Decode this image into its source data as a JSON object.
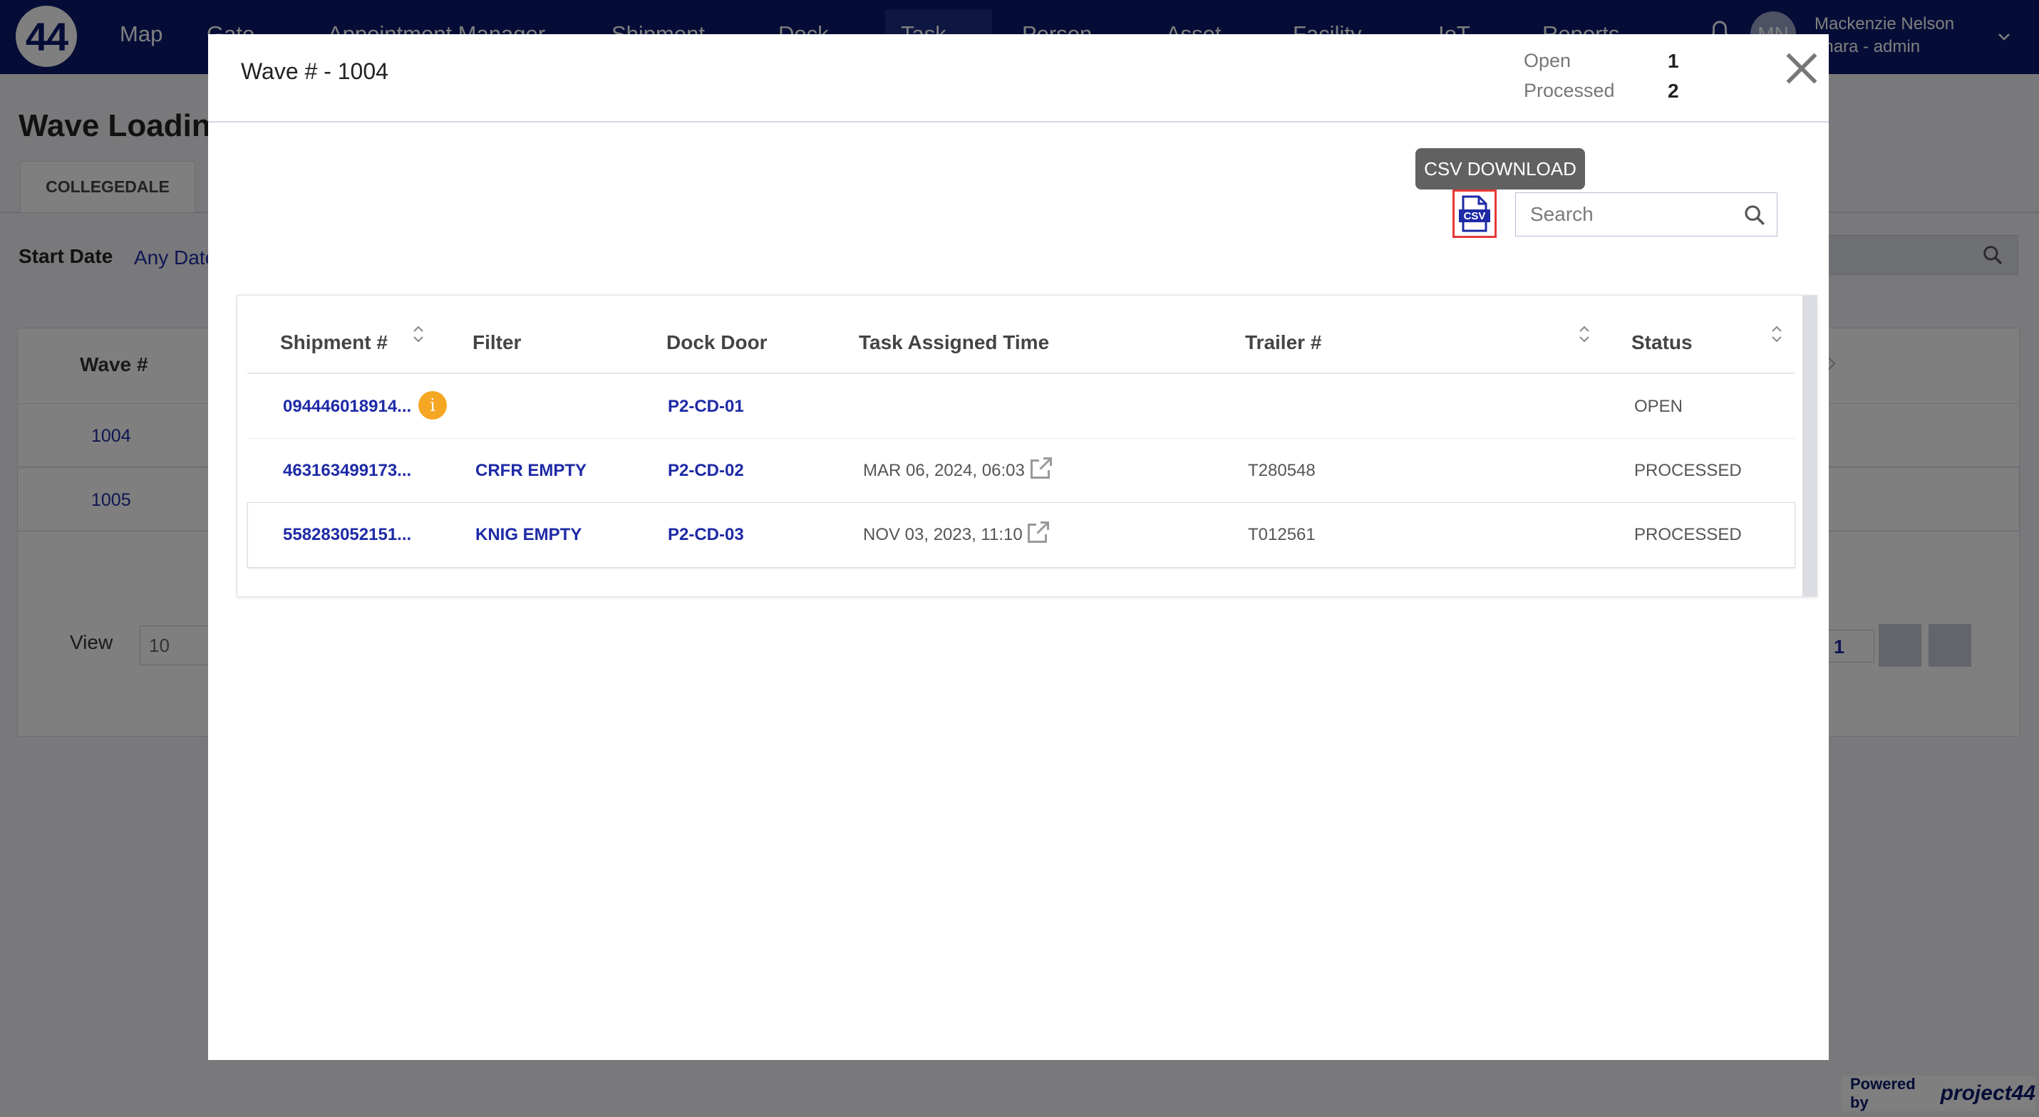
{
  "topnav": {
    "logo": "44",
    "items": [
      "Map",
      "Gate",
      "Appointment Manager",
      "Shipment",
      "Dock",
      "Task",
      "Person",
      "Asset",
      "Facility",
      "IoT",
      "Reports"
    ],
    "user_initials": "MN",
    "user_name": "Mackenzie Nelson",
    "user_org": "ahara - admin"
  },
  "background": {
    "page_title": "Wave Loading",
    "tab": "COLLEGEDALE",
    "start_date_label": "Start Date",
    "start_date_value": "Any Date",
    "wave_header": "Wave #",
    "rows": [
      "1004",
      "1005"
    ],
    "view_label": "View",
    "view_value": "10",
    "page_number": "1",
    "powered_by": "Powered by",
    "powered_brand": "project44"
  },
  "modal": {
    "title": "Wave # - 1004",
    "stats": {
      "open_label": "Open",
      "open_value": "1",
      "processed_label": "Processed",
      "processed_value": "2"
    },
    "tooltip": "CSV DOWNLOAD",
    "csv_icon_label": "CSV",
    "search_placeholder": "Search",
    "table": {
      "headers": {
        "shipment": "Shipment #",
        "filter": "Filter",
        "dock_door": "Dock Door",
        "task_time": "Task Assigned Time",
        "trailer": "Trailer #",
        "status": "Status"
      },
      "rows": [
        {
          "shipment": "094446018914...",
          "filter": "",
          "dock_door": "P2-CD-01",
          "task_time": "",
          "trailer": "",
          "status": "OPEN",
          "info": "i"
        },
        {
          "shipment": "463163499173...",
          "filter": "CRFR EMPTY",
          "dock_door": "P2-CD-02",
          "task_time": "MAR 06, 2024, 06:03",
          "trailer": "T280548",
          "status": "PROCESSED"
        },
        {
          "shipment": "558283052151...",
          "filter": "KNIG EMPTY",
          "dock_door": "P2-CD-03",
          "task_time": "NOV 03, 2023, 11:10",
          "trailer": "T012561",
          "status": "PROCESSED"
        }
      ]
    }
  }
}
